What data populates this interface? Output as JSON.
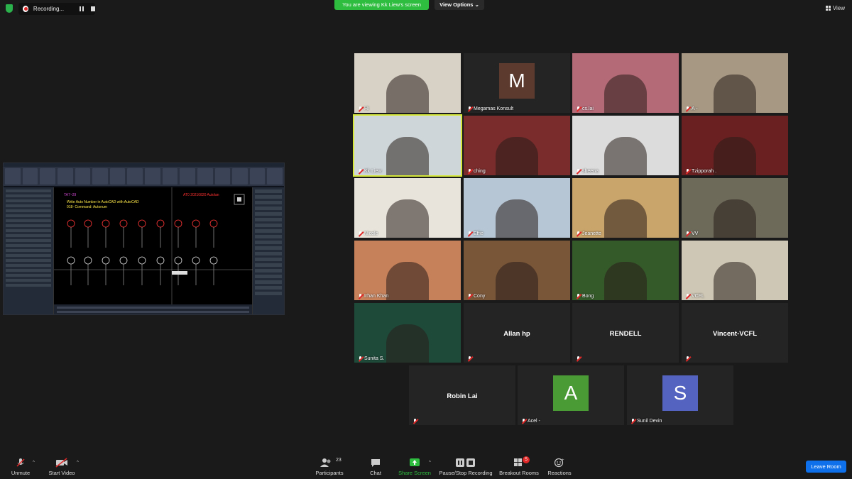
{
  "topbar": {
    "recording_label": "Recording...",
    "viewing_banner": "You are viewing Kk Liew's screen",
    "view_options": "View Options",
    "view_label": "View"
  },
  "shared_screen": {
    "tag": "TA7~29",
    "date_code": "AT0 20210820 Autolan",
    "line1": "Write Auto Number in AutoCAD with AutoCAD",
    "line2": "018- Command: Autonum"
  },
  "participants": [
    {
      "name": "Hi",
      "kind": "video",
      "muted": true,
      "bg": "#d8d2c6"
    },
    {
      "name": "Megamas Konsult",
      "kind": "avatar",
      "letter": "M",
      "color": "#5c3a2e",
      "muted": true
    },
    {
      "name": "cs.lai",
      "kind": "video",
      "muted": true,
      "bg": "#b56a78"
    },
    {
      "name": "A -",
      "kind": "video",
      "muted": true,
      "bg": "#a79884"
    },
    {
      "name": "Kk Liew",
      "kind": "video",
      "muted": true,
      "bg": "#cfd6da",
      "active": true
    },
    {
      "name": "ching",
      "kind": "video",
      "muted": true,
      "bg": "#7a2c2c"
    },
    {
      "name": "sheena",
      "kind": "video",
      "muted": true,
      "bg": "#dcdcdc"
    },
    {
      "name": "Tzipporah .",
      "kind": "video",
      "muted": true,
      "bg": "#6a2020"
    },
    {
      "name": "Nicole",
      "kind": "video",
      "muted": true,
      "bg": "#e8e4dc"
    },
    {
      "name": "Effie",
      "kind": "video",
      "muted": true,
      "bg": "#b7c6d4"
    },
    {
      "name": "Jeanette",
      "kind": "video",
      "muted": true,
      "bg": "#c9a46b"
    },
    {
      "name": "VV",
      "kind": "video",
      "muted": true,
      "bg": "#6d6a5a"
    },
    {
      "name": "Irhan Khan",
      "kind": "video",
      "muted": true,
      "bg": "#c7815a"
    },
    {
      "name": "Cony",
      "kind": "video",
      "muted": true,
      "bg": "#7a5638"
    },
    {
      "name": "Bong",
      "kind": "video",
      "muted": true,
      "bg": "#355a2a"
    },
    {
      "name": "VCFL",
      "kind": "video",
      "muted": true,
      "bg": "#cfc7b5"
    },
    {
      "name": "Sunita S.",
      "kind": "video",
      "muted": true,
      "bg": "#1e4a3a"
    },
    {
      "name": "Allan hp",
      "kind": "name",
      "muted": true
    },
    {
      "name": "RENDELL",
      "kind": "name",
      "muted": true
    },
    {
      "name": "Vincent-VCFL",
      "kind": "name",
      "muted": true
    },
    {
      "name": "Robin Lai",
      "kind": "name",
      "muted": true
    },
    {
      "name": "Acel -",
      "kind": "avatar",
      "letter": "A",
      "color": "#4a9a36",
      "muted": true
    },
    {
      "name": "Sunil Devin",
      "kind": "avatar",
      "letter": "S",
      "color": "#5463c0",
      "muted": true
    }
  ],
  "toolbar": {
    "unmute": "Unmute",
    "start_video": "Start Video",
    "participants": "Participants",
    "participants_count": "23",
    "chat": "Chat",
    "share_screen": "Share Screen",
    "pause_stop": "Pause/Stop Recording",
    "breakout": "Breakout Rooms",
    "breakout_badge": "5",
    "reactions": "Reactions",
    "leave": "Leave Room"
  },
  "colors": {
    "accent_green": "#2ebd3f",
    "leave_blue": "#0e71eb",
    "mute_red": "#e02828"
  }
}
